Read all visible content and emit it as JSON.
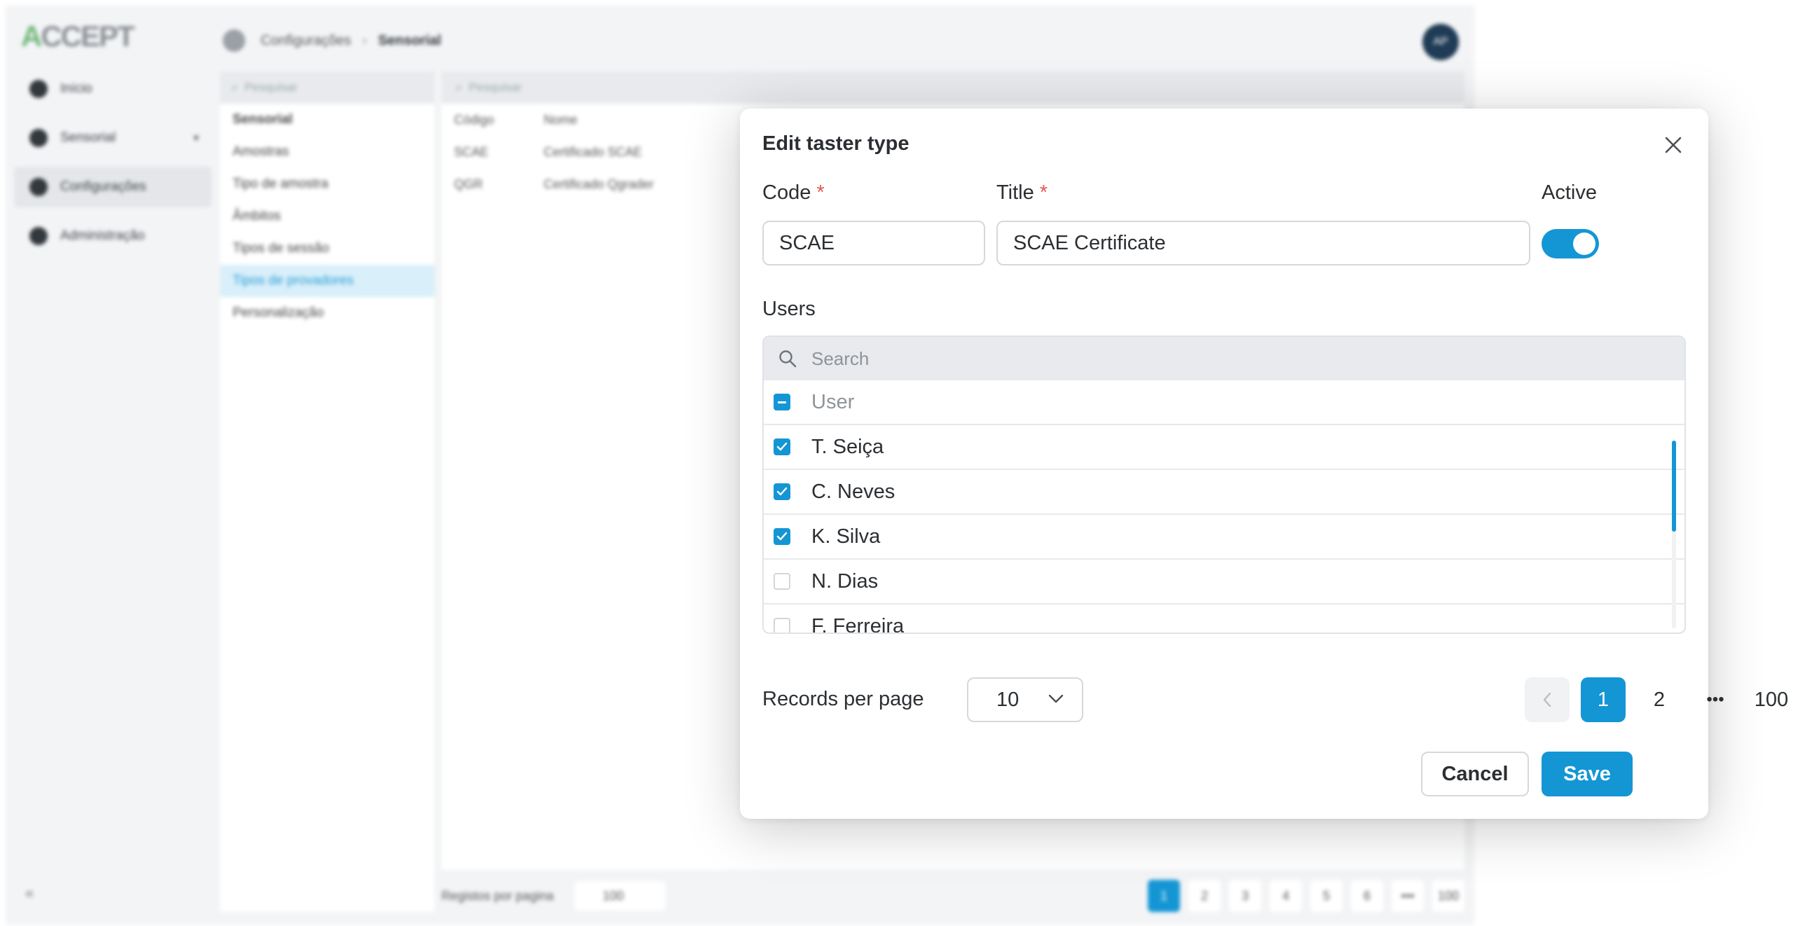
{
  "background_app": {
    "logo": "CCEPT",
    "logo_accent": "A",
    "nav": [
      {
        "label": "Início",
        "icon": "home-icon"
      },
      {
        "label": "Sensorial",
        "icon": "globe-icon"
      },
      {
        "label": "Configurações",
        "icon": "gear-icon"
      },
      {
        "label": "Administração",
        "icon": "admin-icon"
      }
    ],
    "breadcrumb": {
      "parent": "Configurações",
      "current": "Sensorial"
    },
    "avatar": "AP",
    "tree": {
      "search_placeholder": "Pesquisar",
      "root": "Sensorial",
      "items": [
        "Amostras",
        "Tipo de amostra",
        "Âmbitos",
        "Tipos de sessão",
        "Tipos de provadores",
        "Personalização"
      ]
    },
    "grid": {
      "search_placeholder": "Pesquisar",
      "columns": [
        "Código",
        "Nome"
      ],
      "rows": [
        [
          "SCAE",
          "Certificado SCAE"
        ],
        [
          "QGR",
          "Certificado Qgrader"
        ]
      ],
      "footer_label": "Registos por pagina",
      "page_size": "100",
      "pages": [
        "1",
        "2",
        "3",
        "4",
        "5",
        "6",
        "•••",
        "100"
      ]
    }
  },
  "modal": {
    "title": "Edit taster type",
    "code_label": "Code",
    "code_value": "SCAE",
    "title_label": "Title",
    "title_value": "SCAE Certificate",
    "active_label": "Active",
    "active": true,
    "required_mark": "*",
    "users_label": "Users",
    "search_placeholder": "Search",
    "column_header": "User",
    "users": [
      {
        "name": "T. Seiça",
        "checked": true
      },
      {
        "name": "C. Neves",
        "checked": true
      },
      {
        "name": "K. Silva",
        "checked": true
      },
      {
        "name": "N. Dias",
        "checked": false
      },
      {
        "name": "F. Ferreira",
        "checked": false
      }
    ],
    "records_per_page_label": "Records per page",
    "records_per_page": "10",
    "pages": [
      "1",
      "2",
      "•••",
      "100"
    ],
    "current_page": "1",
    "cancel_label": "Cancel",
    "save_label": "Save"
  },
  "colors": {
    "accent": "#1496d4",
    "required": "#e05a4e"
  }
}
